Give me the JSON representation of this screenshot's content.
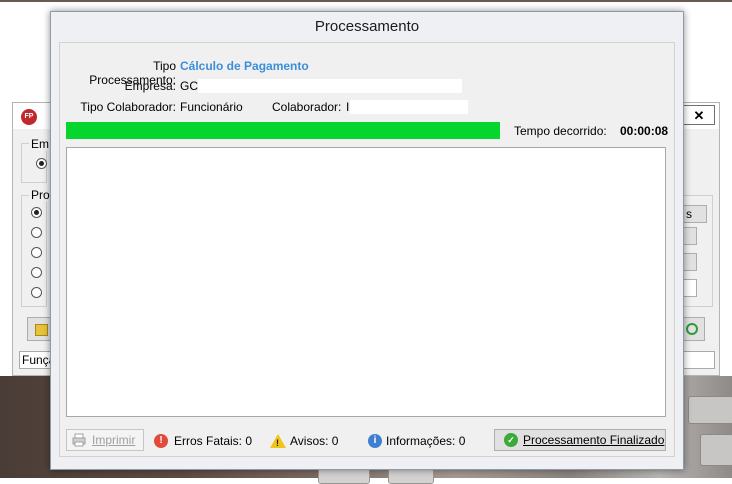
{
  "background_window": {
    "group1_label": "Em",
    "group2_label": "Pro",
    "right_button_label": "s",
    "input_value": "Funçã"
  },
  "dialog": {
    "title": "Processamento",
    "tipo_processamento_label": "Tipo Processamento:",
    "tipo_processamento_value": "Cálculo de Pagamento",
    "empresa_label": "Empresa:",
    "empresa_value": "GC(",
    "tipo_colaborador_label": "Tipo Colaborador:",
    "tipo_colaborador_value": "Funcionário",
    "colaborador_label": "Colaborador:",
    "colaborador_value": "I",
    "progress_fraction": 1.0,
    "tempo_label": "Tempo decorrido:",
    "tempo_value": "00:00:08",
    "imprimir_label": "Imprimir",
    "erros_label": "Erros Fatais: 0",
    "avisos_label": "Avisos: 0",
    "informacoes_label": "Informações: 0",
    "finalizado_label": "Processamento Finalizado"
  },
  "colors": {
    "progress": "#06d52e",
    "accent_text": "#3a8fdc"
  }
}
